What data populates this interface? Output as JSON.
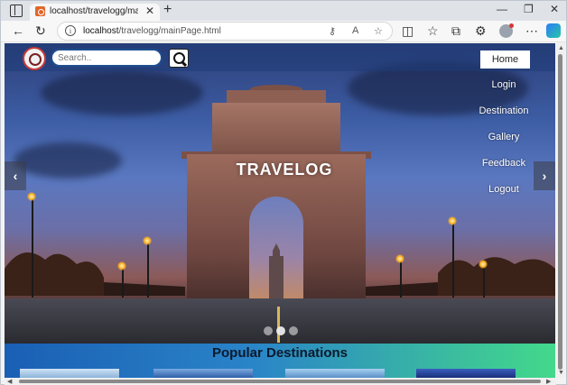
{
  "browser": {
    "tab_title": "localhost/travelogg/mainPage.ht",
    "url_host": "localhost",
    "url_path": "/travelogg/mainPage.html"
  },
  "page": {
    "search": {
      "placeholder": "Search.."
    },
    "nav": {
      "home": "Home",
      "items": [
        "Login",
        "Destination",
        "Gallery",
        "Feedback",
        "Logout"
      ]
    },
    "hero": {
      "title": "TRAVELOG"
    },
    "carousel": {
      "prev_glyph": "‹",
      "next_glyph": "›",
      "slide_count": 3,
      "active_slide": 2
    },
    "section_title": "Popular Destinations"
  },
  "colors": {
    "nav_overlay": "#1e3c78",
    "section_gradient_start": "#1a5fb4",
    "section_gradient_end": "#43d98a",
    "search_border": "#1f4f8f"
  },
  "icons": [
    "window-menu-icon",
    "close-icon",
    "plus-icon",
    "back-icon",
    "refresh-icon",
    "info-icon",
    "key-icon",
    "read-aloud-icon",
    "star-icon",
    "split-screen-icon",
    "favorites-icon",
    "collections-icon",
    "extensions-icon",
    "profile-icon",
    "more-icon",
    "copilot-icon",
    "search-icon",
    "logo-icon"
  ]
}
